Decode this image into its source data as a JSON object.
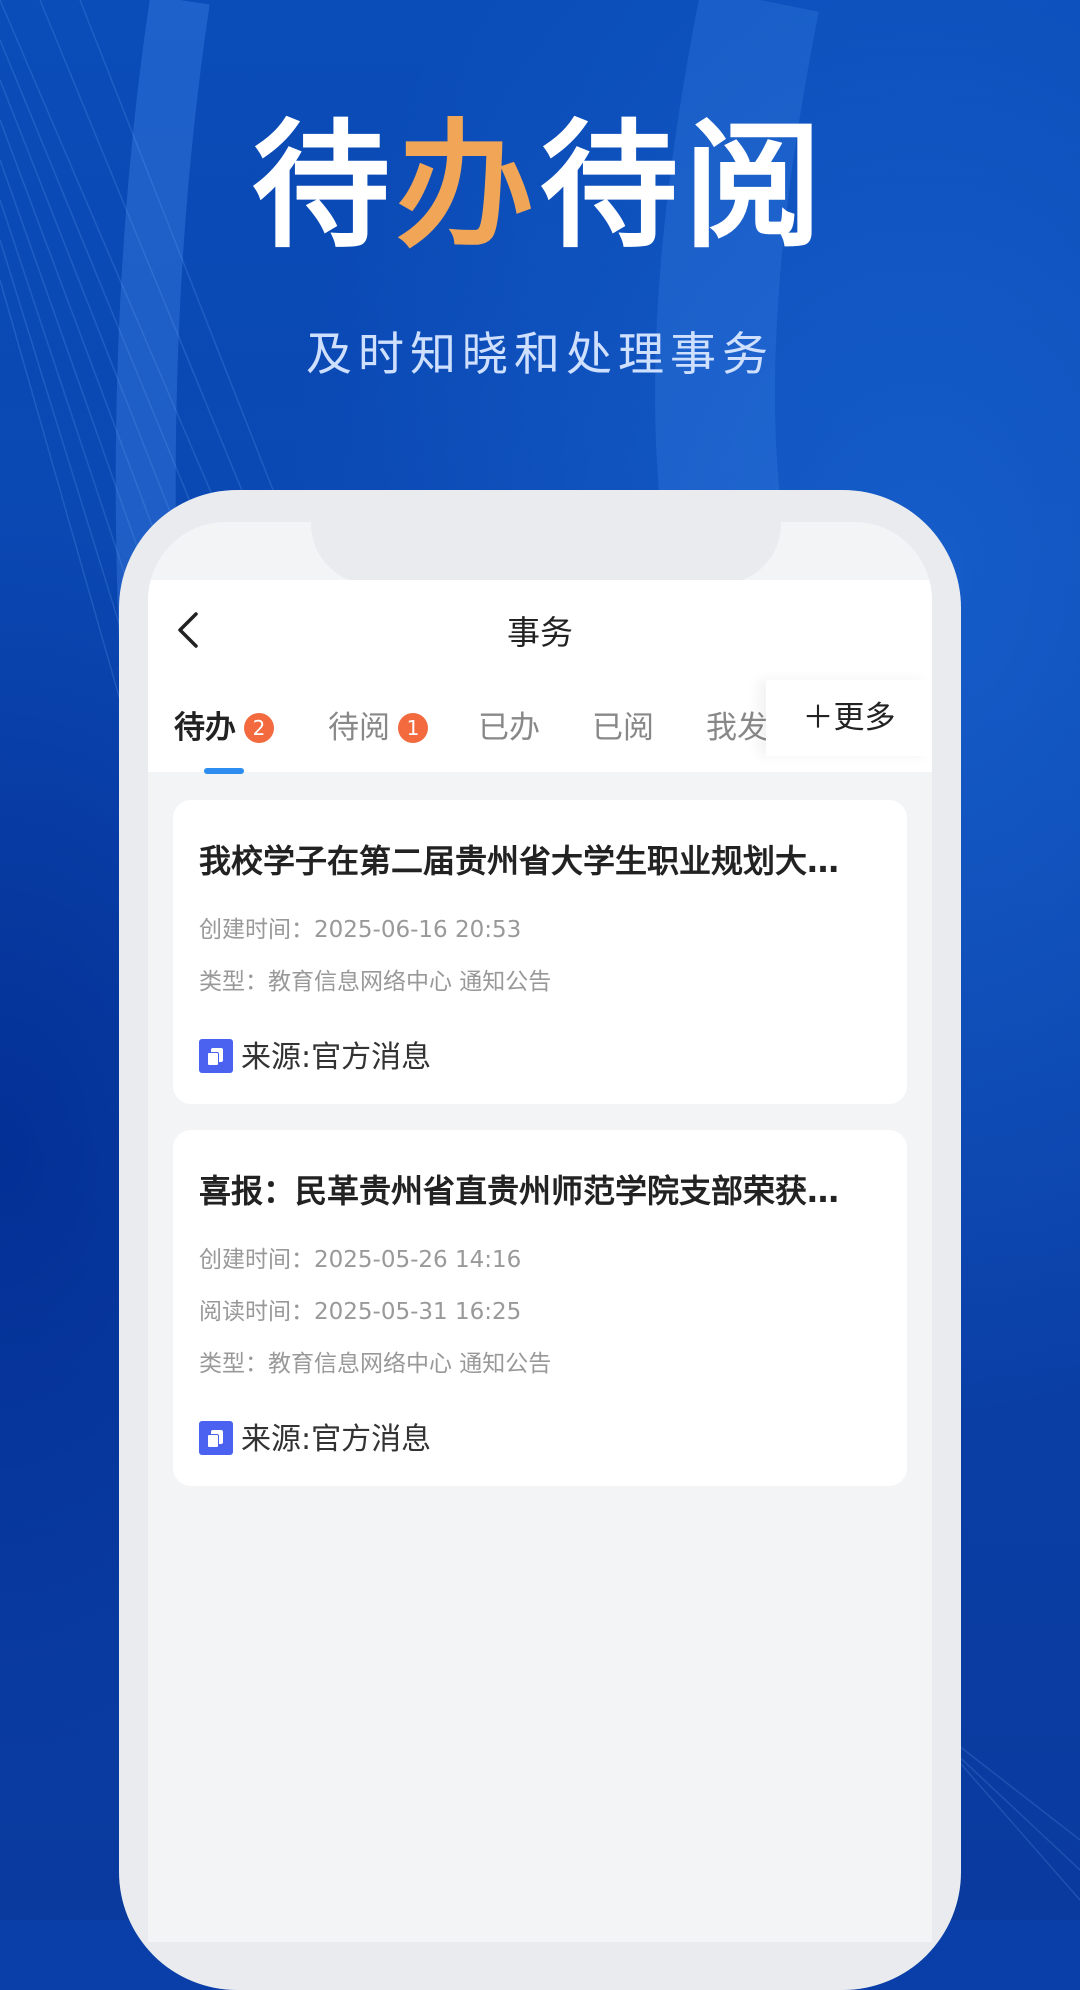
{
  "hero": {
    "title_part1": "待",
    "title_part2": "办",
    "title_part3": "待阅",
    "subtitle": "及时知晓和处理事务"
  },
  "colors": {
    "background": "#0a46b0",
    "accent": "#f0a557",
    "badge": "#f26a3d",
    "tab_indicator": "#2d8cf0",
    "source_icon": "#4b62f0"
  },
  "navbar": {
    "title": "事务",
    "back_icon": "chevron-left-icon"
  },
  "tabs": [
    {
      "label": "待办",
      "badge": "2"
    },
    {
      "label": "待阅",
      "badge": "1"
    },
    {
      "label": "已办"
    },
    {
      "label": "已阅"
    },
    {
      "label": "我发"
    }
  ],
  "more_button": "＋更多",
  "items": [
    {
      "title": "我校学子在第二届贵州省大学生职业规划大…",
      "created": "创建时间：2025-06-16 20:53",
      "type": "类型：教育信息网络中心 通知公告",
      "source": "来源:官方消息"
    },
    {
      "title": "喜报：民革贵州省直贵州师范学院支部荣获…",
      "created": "创建时间：2025-05-26 14:16",
      "read": "阅读时间：2025-05-31 16:25",
      "type": "类型：教育信息网络中心 通知公告",
      "source": "来源:官方消息"
    }
  ]
}
